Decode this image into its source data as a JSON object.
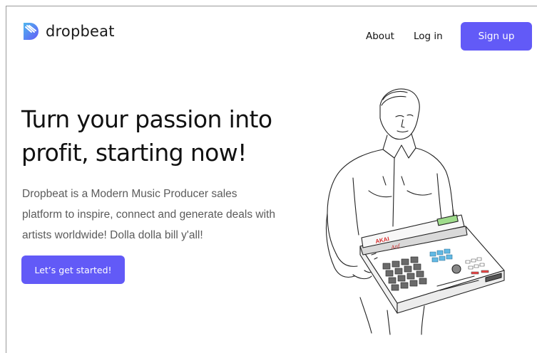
{
  "brand": {
    "name": "dropbeat",
    "logo_icon": "dropbeat-logo-icon",
    "logo_colors": [
      "#625af7",
      "#4fb6ee"
    ]
  },
  "nav": {
    "about_label": "About",
    "login_label": "Log in",
    "signup_label": "Sign up"
  },
  "hero": {
    "title": "Turn your passion into profit, starting now!",
    "description": "Dropbeat is a Modern Music Producer sales platform to inspire, connect and generate deals with artists worldwide! Dolla dolla bill y'all!",
    "cta_label": "Let’s get started!",
    "illustration": "producer-holding-akai-mpc-illustration",
    "illustration_labels": {
      "brand": "AKAI",
      "signature": "Anf"
    }
  },
  "colors": {
    "accent": "#625af7",
    "text": "#111111",
    "muted_text": "#5b5b5b",
    "screen": "#9fdc8c",
    "pads_blue": "#62b9e4"
  }
}
